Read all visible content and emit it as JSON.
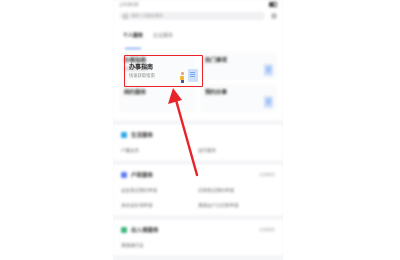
{
  "status_bar": {
    "left_text": "上午10:22",
    "right_text": ""
  },
  "search": {
    "placeholder": "搜索人员服务事项"
  },
  "tabs": [
    {
      "label": "个人服务"
    },
    {
      "label": "企业服务"
    }
  ],
  "cards": [
    {
      "title": "办事指南",
      "subtitle": "快速获取指南"
    },
    {
      "title": "热门事项",
      "subtitle": ""
    },
    {
      "title": "网约服务",
      "subtitle": ""
    },
    {
      "title": "预约办事",
      "subtitle": ""
    }
  ],
  "sections": [
    {
      "title": "生活服务",
      "more": "",
      "links": [
        "户籍业务",
        "出行服务"
      ],
      "color": "#2aa7e8"
    },
    {
      "title": "户政服务",
      "more": "全部服务",
      "links": [
        "出生登记预约申请",
        "迁移登记预约申请",
        "身份证补领申请",
        "港澳台户口迁移申请"
      ],
      "color": "#5b7cf0"
    },
    {
      "title": "出入境服务",
      "more": "全部服务",
      "links": [
        "港澳通行证",
        ""
      ],
      "color": "#3ab57a"
    }
  ],
  "highlight": {
    "title": "办事指南",
    "subtitle": "快速获取指南"
  },
  "colors": {
    "highlight": "#e8242a",
    "accent": "#2f6fed"
  }
}
